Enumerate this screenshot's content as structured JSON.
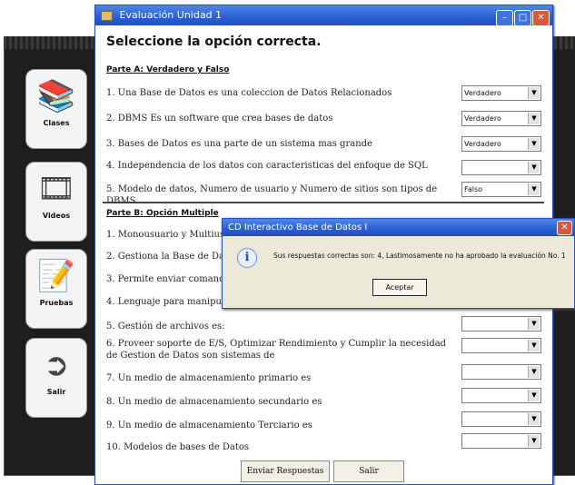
{
  "sidebar": {
    "items": [
      {
        "label": "Clases"
      },
      {
        "label": "Videos"
      },
      {
        "label": "Pruebas"
      },
      {
        "label": "Salir"
      }
    ]
  },
  "window": {
    "title": "Evaluación Unidad 1",
    "heading": "Seleccione la opción correcta.",
    "part_a": {
      "title": "Parte A: Verdadero y Falso",
      "questions": [
        {
          "text": "1. Una Base de Datos es una coleccion de Datos Relacionados",
          "answer": "Verdadero"
        },
        {
          "text": "2. DBMS Es un software que crea bases de datos",
          "answer": "Verdadero"
        },
        {
          "text": "3. Bases de Datos es una parte de un sistema mas grande",
          "answer": "Verdadero"
        },
        {
          "text": "4. Independencia de los datos con caracteristicas del enfoque de SQL",
          "answer": ""
        },
        {
          "text": "5. Modelo de datos, Numero de usuario y Numero de sitios son tipos de DBMS",
          "answer": "Falso"
        }
      ]
    },
    "part_b": {
      "title": "Parte B: Opción Multiple",
      "questions": [
        {
          "text": "1. Monousuario y Multius",
          "answer": ""
        },
        {
          "text": "2. Gestiona la Base de Dato",
          "answer": ""
        },
        {
          "text": "3. Permite enviar comand",
          "answer": ""
        },
        {
          "text": "4. Lenguaje para manipula",
          "answer": ""
        },
        {
          "text": "5. Gestión de archivos es:",
          "answer": ""
        },
        {
          "text": "6. Proveer soporte de E/S, Optimizar Rendimiento y Cumplir la necesidad de Gestion de Datos son sistemas de",
          "answer": ""
        },
        {
          "text": "7. Un medio de almacenamiento primario es",
          "answer": ""
        },
        {
          "text": "8. Un medio de almacenamiento secundario es",
          "answer": ""
        },
        {
          "text": "9. Un medio de almacenamiento Terciario es",
          "answer": ""
        },
        {
          "text": "10. Modelos de bases de Datos",
          "answer": ""
        }
      ]
    },
    "submit_label": "Enviar Respuestas",
    "exit_label": "Salir"
  },
  "dialog": {
    "title": "CD Interactivo Base de Datos I",
    "message": "Sus respuestas correctas son: 4, Lastimosamente no ha aprobado la evaluación No. 1",
    "ok_label": "Aceptar"
  },
  "colors": {
    "titlebar": "#2a5fd4",
    "close": "#d9573c",
    "dark_bg": "#1e1e1e"
  },
  "icons": {
    "window": "window-icon",
    "info": "info-icon",
    "dropdown": "dropdown-arrow-icon"
  }
}
